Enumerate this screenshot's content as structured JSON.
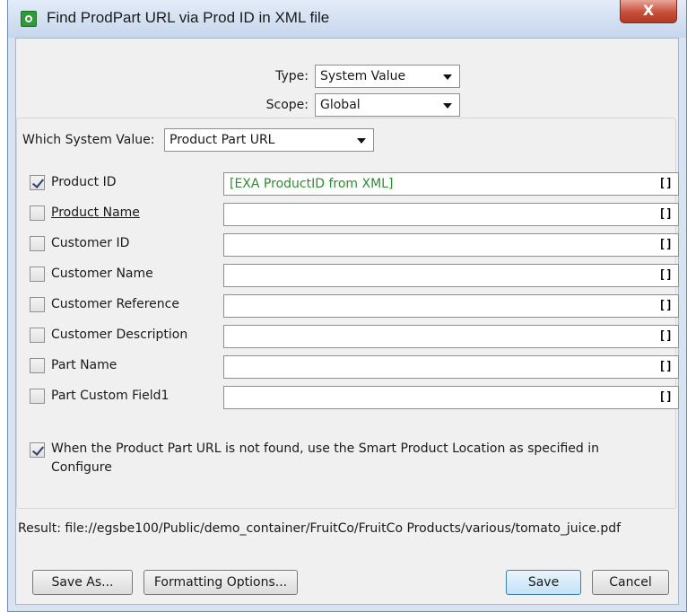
{
  "window": {
    "title": "Find ProdPart URL via Prod ID in XML file",
    "close_label": "X"
  },
  "type": {
    "label": "Type:",
    "value": "System Value"
  },
  "scope": {
    "label": "Scope:",
    "value": "Global"
  },
  "system_value": {
    "label": "Which System Value:",
    "value": "Product Part URL"
  },
  "fields": [
    {
      "label": "Product ID",
      "checked": true,
      "value": "[EXA ProductID from XML]"
    },
    {
      "label": "Product Name",
      "checked": false,
      "value": ""
    },
    {
      "label": "Customer ID",
      "checked": false,
      "value": ""
    },
    {
      "label": "Customer Name",
      "checked": false,
      "value": ""
    },
    {
      "label": "Customer Reference",
      "checked": false,
      "value": ""
    },
    {
      "label": "Customer Description",
      "checked": false,
      "value": ""
    },
    {
      "label": "Part Name",
      "checked": false,
      "value": ""
    },
    {
      "label": "Part Custom Field1",
      "checked": false,
      "value": ""
    }
  ],
  "fallback": {
    "checked": true,
    "line1": "When the Product Part URL is not found, use the Smart Product Location as specified in",
    "line2": "Configure"
  },
  "result": "Result: file://egsbe100/Public/demo_container/FruitCo/FruitCo Products/various/tomato_juice.pdf",
  "buttons": {
    "save_as": "Save As...",
    "formatting": "Formatting Options...",
    "save": "Save",
    "cancel": "Cancel"
  },
  "field_icon": "[]"
}
